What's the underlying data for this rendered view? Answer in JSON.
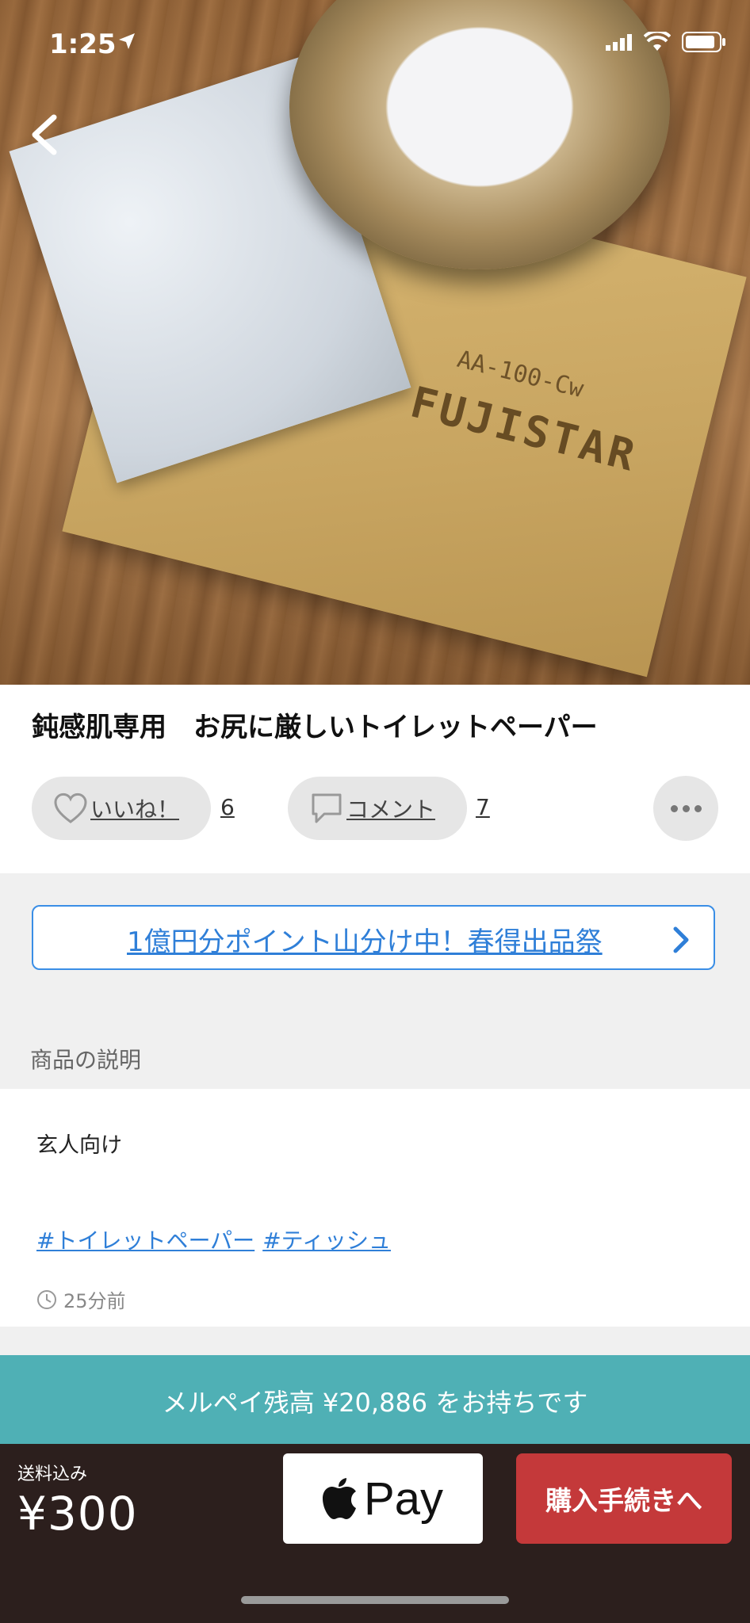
{
  "status_bar": {
    "time": "1:25"
  },
  "product": {
    "title": "鈍感肌専用　お尻に厳しいトイレットペーパー",
    "photo_text": {
      "brand": "FUJISTAR",
      "grade": "AA-100-Cw"
    }
  },
  "actions": {
    "like_label": "いいね！",
    "like_count": "6",
    "comment_label": "コメント",
    "comment_count": "7"
  },
  "campaign": {
    "text": "1億円分ポイント山分け中！春得出品祭"
  },
  "description": {
    "section_label": "商品の説明",
    "body": "玄人向け",
    "tags": [
      "#トイレットペーパー",
      "#ティッシュ"
    ],
    "posted": "25分前"
  },
  "wallet_banner": {
    "text": "メルペイ残高 ¥20,886 をお持ちです"
  },
  "purchase": {
    "shipping_label": "送料込み",
    "price": "¥300",
    "applepay_label": "Pay",
    "buy_label": "購入手続きへ"
  },
  "colors": {
    "accent_blue": "#2f7fd8",
    "buy_red": "#c4393a",
    "banner_teal": "#4fb0b5",
    "bottom_bar": "#2c1f1d"
  }
}
